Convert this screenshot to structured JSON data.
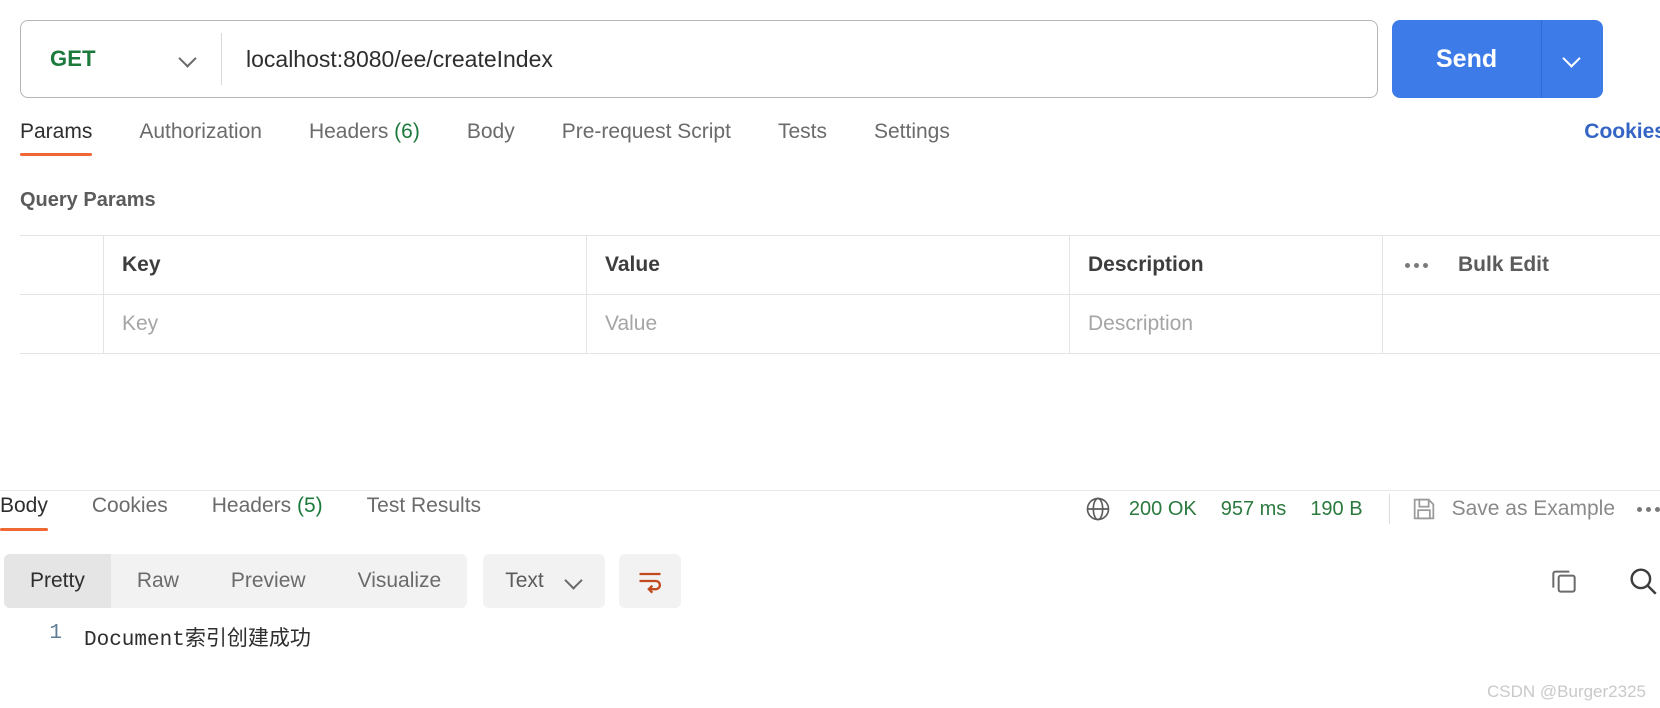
{
  "request": {
    "method": "GET",
    "method_chevron_icon": "chevron-down-icon",
    "url_value": "localhost:8080/ee/createIndex",
    "url_placeholder": "Enter request URL",
    "send_label": "Send",
    "send_chevron_icon": "chevron-down-icon"
  },
  "request_tabs": [
    {
      "label": "Params",
      "count": "",
      "active": true
    },
    {
      "label": "Authorization",
      "count": "",
      "active": false
    },
    {
      "label": "Headers",
      "count": "(6)",
      "active": false
    },
    {
      "label": "Body",
      "count": "",
      "active": false
    },
    {
      "label": "Pre-request Script",
      "count": "",
      "active": false
    },
    {
      "label": "Tests",
      "count": "",
      "active": false
    },
    {
      "label": "Settings",
      "count": "",
      "active": false
    }
  ],
  "cookies_link": "Cookies",
  "query_params": {
    "section_title": "Query Params",
    "columns": [
      "Key",
      "Value",
      "Description"
    ],
    "bulk_edit_label": "Bulk Edit",
    "more_icon": "more-horizontal-icon",
    "rows": [
      {
        "key_placeholder": "Key",
        "value_placeholder": "Value",
        "description_placeholder": "Description"
      }
    ]
  },
  "response_tabs": [
    {
      "label": "Body",
      "count": "",
      "active": true
    },
    {
      "label": "Cookies",
      "count": "",
      "active": false
    },
    {
      "label": "Headers",
      "count": "(5)",
      "active": false
    },
    {
      "label": "Test Results",
      "count": "",
      "active": false
    }
  ],
  "response_meta": {
    "network_icon": "globe-icon",
    "status": "200 OK",
    "time": "957 ms",
    "size": "190 B",
    "save_icon": "save-icon",
    "save_as_example": "Save as Example",
    "more_icon": "more-horizontal-icon"
  },
  "view_toolbar": {
    "modes": [
      {
        "label": "Pretty",
        "active": true
      },
      {
        "label": "Raw",
        "active": false
      },
      {
        "label": "Preview",
        "active": false
      },
      {
        "label": "Visualize",
        "active": false
      }
    ],
    "format": "Text",
    "format_chevron_icon": "chevron-down-icon",
    "wrap_icon": "word-wrap-icon",
    "copy_icon": "copy-icon",
    "search_icon": "search-icon"
  },
  "response_body": {
    "lines": [
      {
        "number": "1",
        "text": "Document索引创建成功"
      }
    ]
  },
  "watermark": "CSDN @Burger2325",
  "colors": {
    "accent_orange": "#ef6733",
    "send_blue": "#3d7ce8",
    "link_blue": "#3565c4",
    "success_green": "#2c7a3f",
    "method_green": "#1c7a3d"
  }
}
